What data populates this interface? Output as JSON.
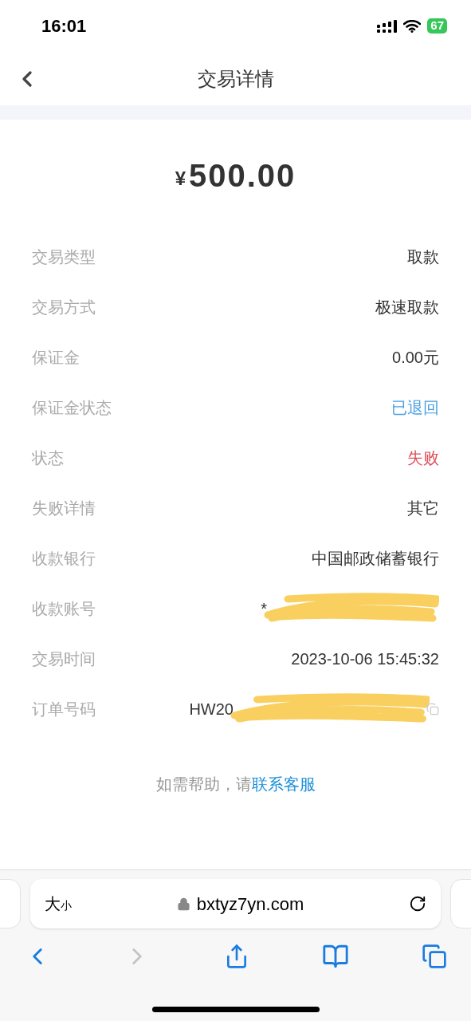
{
  "status_bar": {
    "time": "16:01",
    "battery": "67"
  },
  "nav": {
    "title": "交易详情"
  },
  "amount": {
    "currency": "¥",
    "value": "500.00"
  },
  "rows": [
    {
      "label": "交易类型",
      "value": "取款",
      "color": "#333333",
      "redacted": false,
      "copy": false
    },
    {
      "label": "交易方式",
      "value": "极速取款",
      "color": "#333333",
      "redacted": false,
      "copy": false
    },
    {
      "label": "保证金",
      "value": "0.00元",
      "color": "#333333",
      "redacted": false,
      "copy": false
    },
    {
      "label": "保证金状态",
      "value": "已退回",
      "color": "#4a9fe0",
      "redacted": false,
      "copy": false
    },
    {
      "label": "状态",
      "value": "失败",
      "color": "#e0505a",
      "redacted": false,
      "copy": false
    },
    {
      "label": "失败详情",
      "value": "其它",
      "color": "#333333",
      "redacted": false,
      "copy": false
    },
    {
      "label": "收款银行",
      "value": "中国邮政储蓄银行",
      "color": "#333333",
      "redacted": false,
      "copy": false
    },
    {
      "label": "收款账号",
      "value": "*",
      "color": "#333333",
      "redacted": true,
      "copy": false
    },
    {
      "label": "交易时间",
      "value": "2023-10-06 15:45:32",
      "color": "#333333",
      "redacted": false,
      "copy": false
    },
    {
      "label": "订单号码",
      "value": "HW20",
      "color": "#333333",
      "redacted": true,
      "copy": true
    }
  ],
  "help": {
    "text": "如需帮助，请",
    "link": "联系客服"
  },
  "browser": {
    "text_size_big": "大",
    "text_size_small": "小",
    "url": "bxtyz7yn.com",
    "forward_disabled": true
  }
}
